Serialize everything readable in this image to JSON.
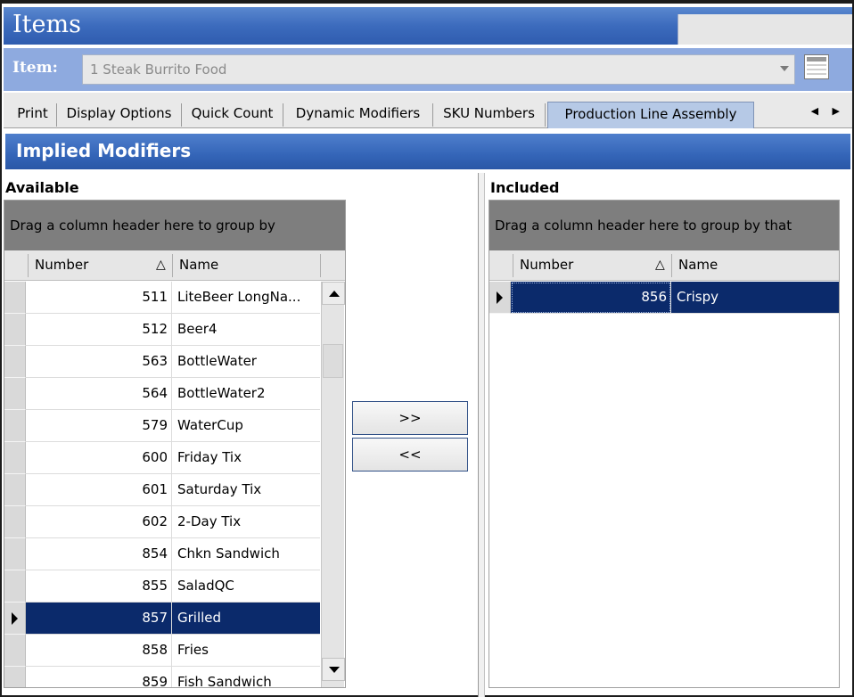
{
  "window": {
    "title": "Items"
  },
  "item_row": {
    "label": "Item:",
    "value": "1 Steak Burrito Food"
  },
  "tabs": [
    {
      "label": "Print"
    },
    {
      "label": "Display Options"
    },
    {
      "label": "Quick Count"
    },
    {
      "label": "Dynamic Modifiers"
    },
    {
      "label": "SKU Numbers"
    },
    {
      "label": "Production Line Assembly",
      "active": true
    }
  ],
  "section": {
    "title": "Implied Modifiers"
  },
  "available": {
    "label": "Available",
    "group_hint": "Drag a column header here to group by",
    "columns": {
      "number": "Number",
      "name": "Name"
    },
    "rows": [
      {
        "number": "511",
        "name": "LiteBeer LongNa..."
      },
      {
        "number": "512",
        "name": "Beer4"
      },
      {
        "number": "563",
        "name": "BottleWater"
      },
      {
        "number": "564",
        "name": "BottleWater2"
      },
      {
        "number": "579",
        "name": "WaterCup"
      },
      {
        "number": "600",
        "name": "Friday Tix"
      },
      {
        "number": "601",
        "name": "Saturday Tix"
      },
      {
        "number": "602",
        "name": "2-Day Tix"
      },
      {
        "number": "854",
        "name": "Chkn Sandwich"
      },
      {
        "number": "855",
        "name": "SaladQC"
      },
      {
        "number": "857",
        "name": "Grilled",
        "selected": true
      },
      {
        "number": "858",
        "name": "Fries"
      },
      {
        "number": "859",
        "name": "Fish Sandwich"
      }
    ]
  },
  "included": {
    "label": "Included",
    "group_hint": "Drag a column header here to group by that",
    "columns": {
      "number": "Number",
      "name": "Name"
    },
    "rows": [
      {
        "number": "856",
        "name": "Crispy",
        "selected": true
      }
    ]
  },
  "buttons": {
    "add": ">>",
    "remove": "<<"
  },
  "colors": {
    "title_blue": "#3c6bbd",
    "selection": "#0b2a6b",
    "item_bar": "#8eaadf",
    "active_tab": "#b6c9e6"
  }
}
